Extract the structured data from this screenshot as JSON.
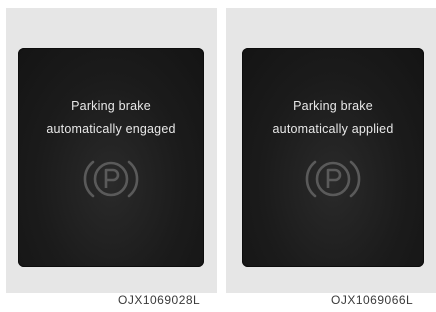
{
  "panels": [
    {
      "line1": "Parking brake",
      "line2": "automatically engaged",
      "code": "OJX1069028L",
      "icon": "parking-brake-icon"
    },
    {
      "line1": "Parking brake",
      "line2": "automatically applied",
      "code": "OJX1069066L",
      "icon": "parking-brake-icon"
    }
  ],
  "colors": {
    "screen": "#1b1b1b",
    "text": "#e8e8e8",
    "icon": "#5a5a5a",
    "panel": "#e6e6e6"
  }
}
